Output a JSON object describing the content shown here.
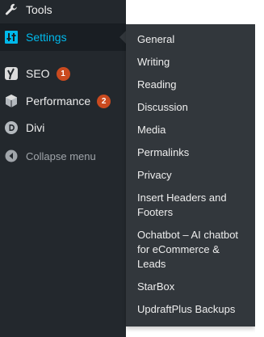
{
  "sidebar": {
    "items": [
      {
        "label": "Tools",
        "icon": "wrench-icon"
      },
      {
        "label": "Settings",
        "icon": "settings-sliders-icon",
        "active": true
      },
      {
        "label": "SEO",
        "icon": "yoast-seo-icon",
        "badge": "1"
      },
      {
        "label": "Performance",
        "icon": "performance-cube-icon",
        "badge": "2"
      },
      {
        "label": "Divi",
        "icon": "divi-icon"
      },
      {
        "label": "Collapse menu",
        "icon": "collapse-arrow-icon"
      }
    ]
  },
  "submenu": {
    "items": [
      "General",
      "Writing",
      "Reading",
      "Discussion",
      "Media",
      "Permalinks",
      "Privacy",
      "Insert Headers and Footers",
      "Ochatbot – AI chatbot for eCommerce & Leads",
      "StarBox",
      "UpdraftPlus Backups"
    ]
  },
  "colors": {
    "sidebar_bg": "#23282d",
    "submenu_bg": "#32373c",
    "active_text": "#00b9eb",
    "badge_bg": "#ca4a1f"
  }
}
